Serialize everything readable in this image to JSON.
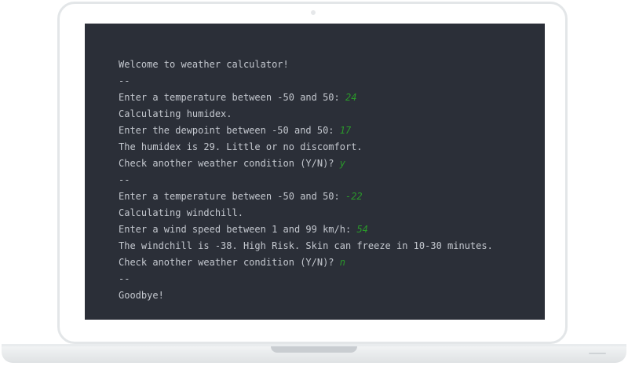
{
  "terminal": {
    "lines": [
      {
        "text": "Welcome to weather calculator!",
        "input": ""
      },
      {
        "text": "--",
        "input": ""
      },
      {
        "text": "Enter a temperature between -50 and 50: ",
        "input": "24"
      },
      {
        "text": "Calculating humidex.",
        "input": ""
      },
      {
        "text": "Enter the dewpoint between -50 and 50: ",
        "input": "17"
      },
      {
        "text": "The humidex is 29. Little or no discomfort.",
        "input": ""
      },
      {
        "text": "Check another weather condition (Y/N)? ",
        "input": "y"
      },
      {
        "text": "--",
        "input": ""
      },
      {
        "text": "Enter a temperature between -50 and 50: ",
        "input": "-22"
      },
      {
        "text": "Calculating windchill.",
        "input": ""
      },
      {
        "text": "Enter a wind speed between 1 and 99 km/h: ",
        "input": "54"
      },
      {
        "text": "The windchill is -38. High Risk. Skin can freeze in 10-30 minutes.",
        "input": ""
      },
      {
        "text": "Check another weather condition (Y/N)? ",
        "input": "n"
      },
      {
        "text": "--",
        "input": ""
      },
      {
        "text": "Goodbye!",
        "input": ""
      }
    ]
  },
  "colors": {
    "screen_background": "#2b2f38",
    "output_text": "#c4c8cf",
    "user_input": "#2a9a2a"
  }
}
